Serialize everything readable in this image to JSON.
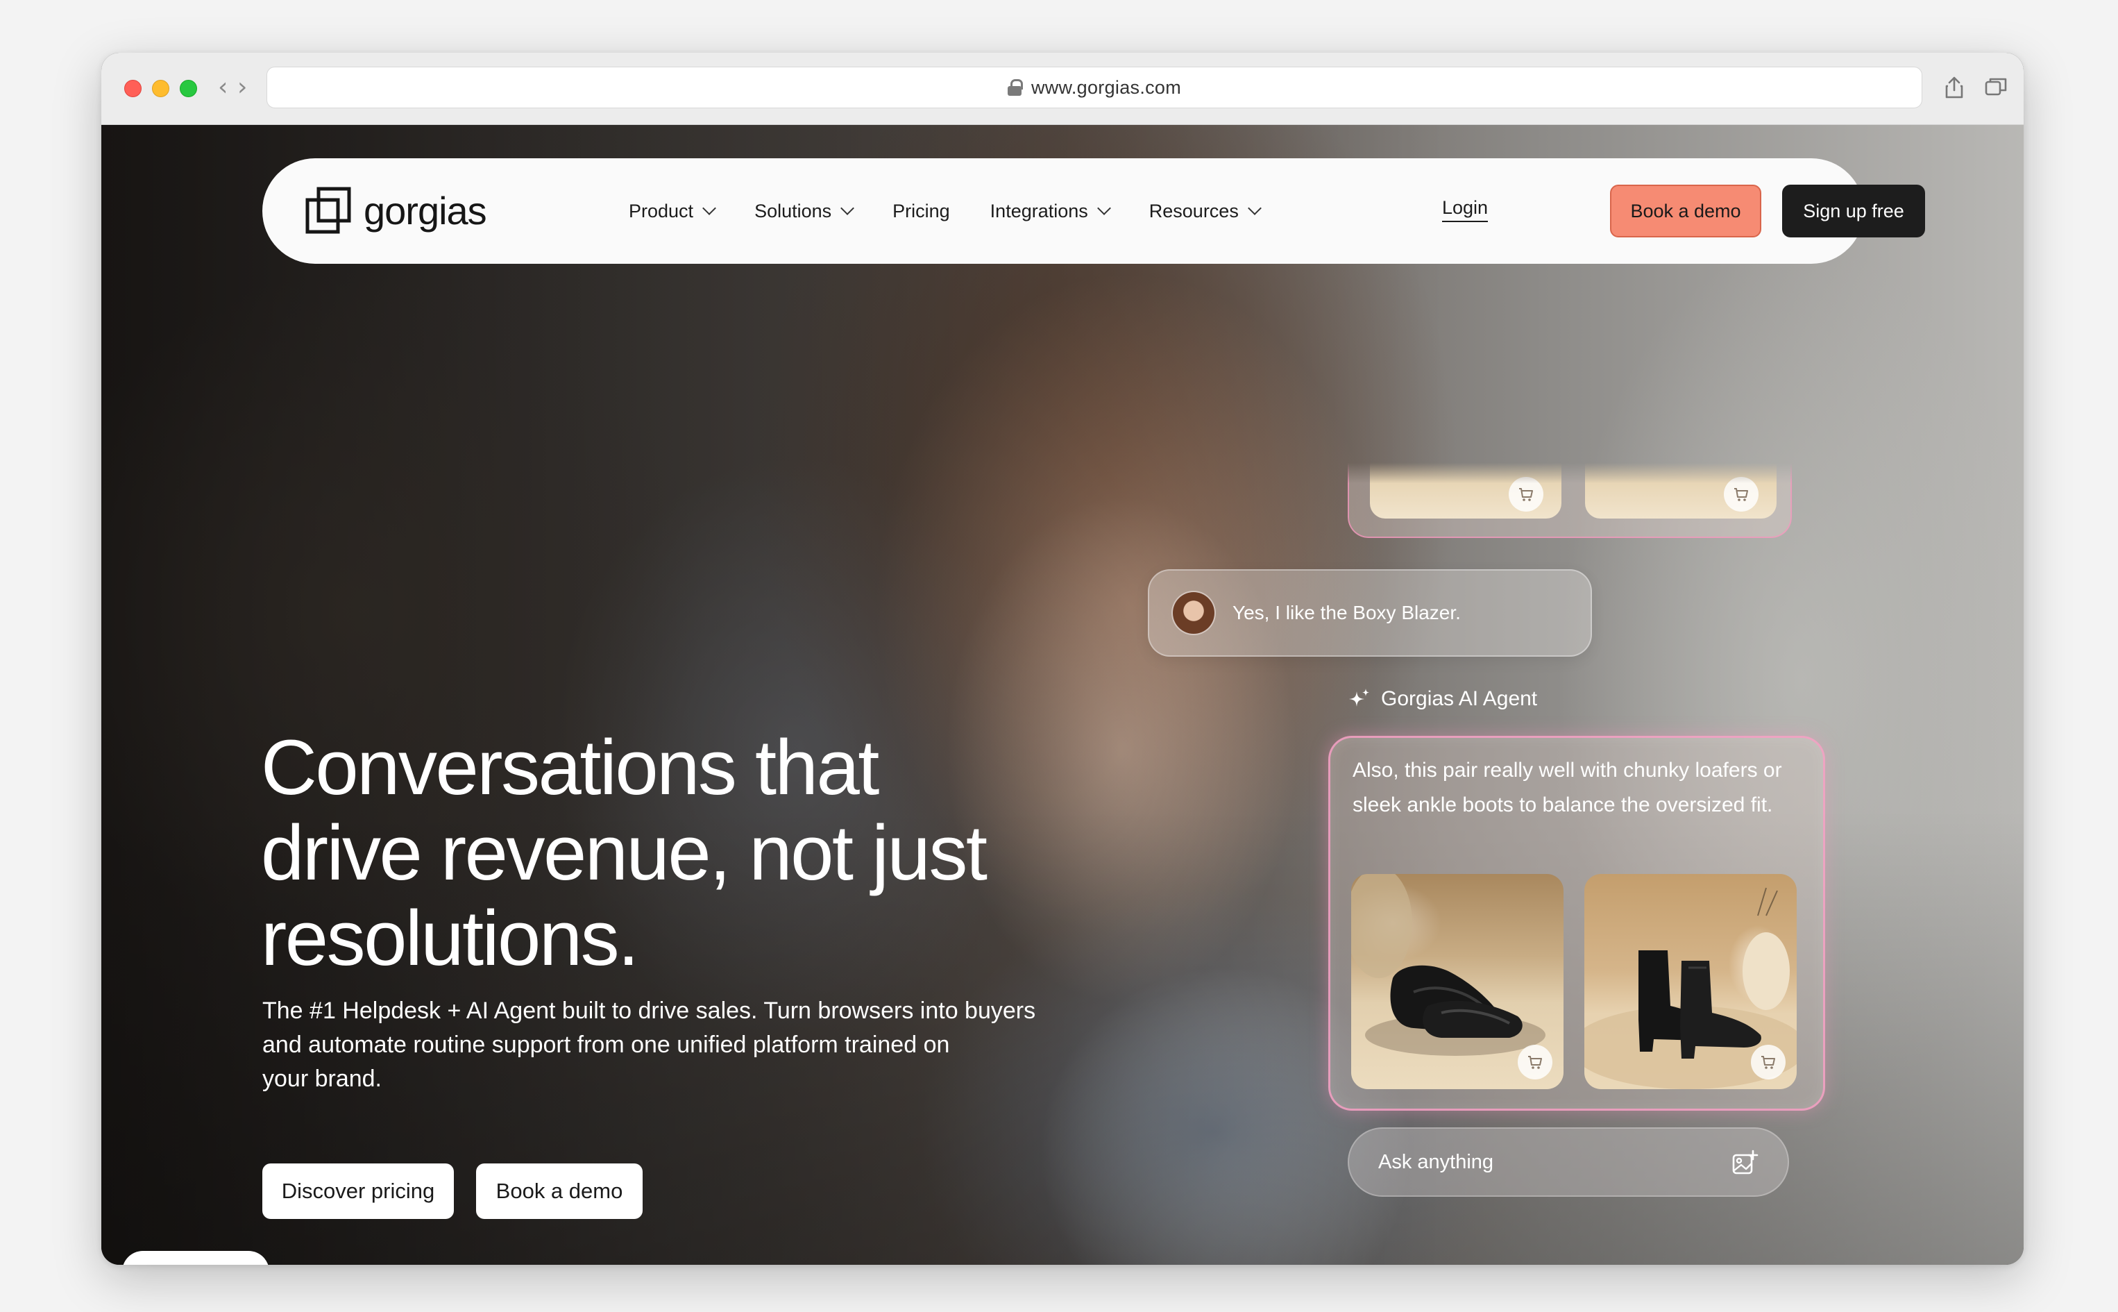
{
  "browser": {
    "url": "www.gorgias.com"
  },
  "nav": {
    "brand": "gorgias",
    "menu": [
      {
        "label": "Product",
        "has_dropdown": true
      },
      {
        "label": "Solutions",
        "has_dropdown": true
      },
      {
        "label": "Pricing",
        "has_dropdown": false
      },
      {
        "label": "Integrations",
        "has_dropdown": true
      },
      {
        "label": "Resources",
        "has_dropdown": true
      }
    ],
    "login": "Login",
    "book_demo": "Book a demo",
    "signup": "Sign up free"
  },
  "hero": {
    "headline_lines": [
      "Conversations that",
      "drive revenue, not just",
      "resolutions."
    ],
    "subtext_lines": [
      "The #1 Helpdesk + AI Agent built to drive sales. Turn browsers into buyers",
      "and automate routine support from one unified platform trained on",
      "your brand."
    ],
    "cta_pricing": "Discover pricing",
    "cta_demo": "Book a demo"
  },
  "chat": {
    "user_message": "Yes, I like the Boxy Blazer.",
    "agent_name": "Gorgias AI Agent",
    "agent_message_lines": [
      "Also, this pair really well with chunky loafers or",
      "sleek ankle boots to balance the oversized fit."
    ],
    "input_placeholder": "Ask anything"
  },
  "colors": {
    "demo_button": "#f68b73",
    "signup_button": "#1d1d1d",
    "card_glow": "#f696be"
  },
  "icons": [
    "lock-icon",
    "share-icon",
    "tabs-icon",
    "chevron-down-icon",
    "sparkle-icon",
    "cart-icon",
    "image-add-icon"
  ]
}
